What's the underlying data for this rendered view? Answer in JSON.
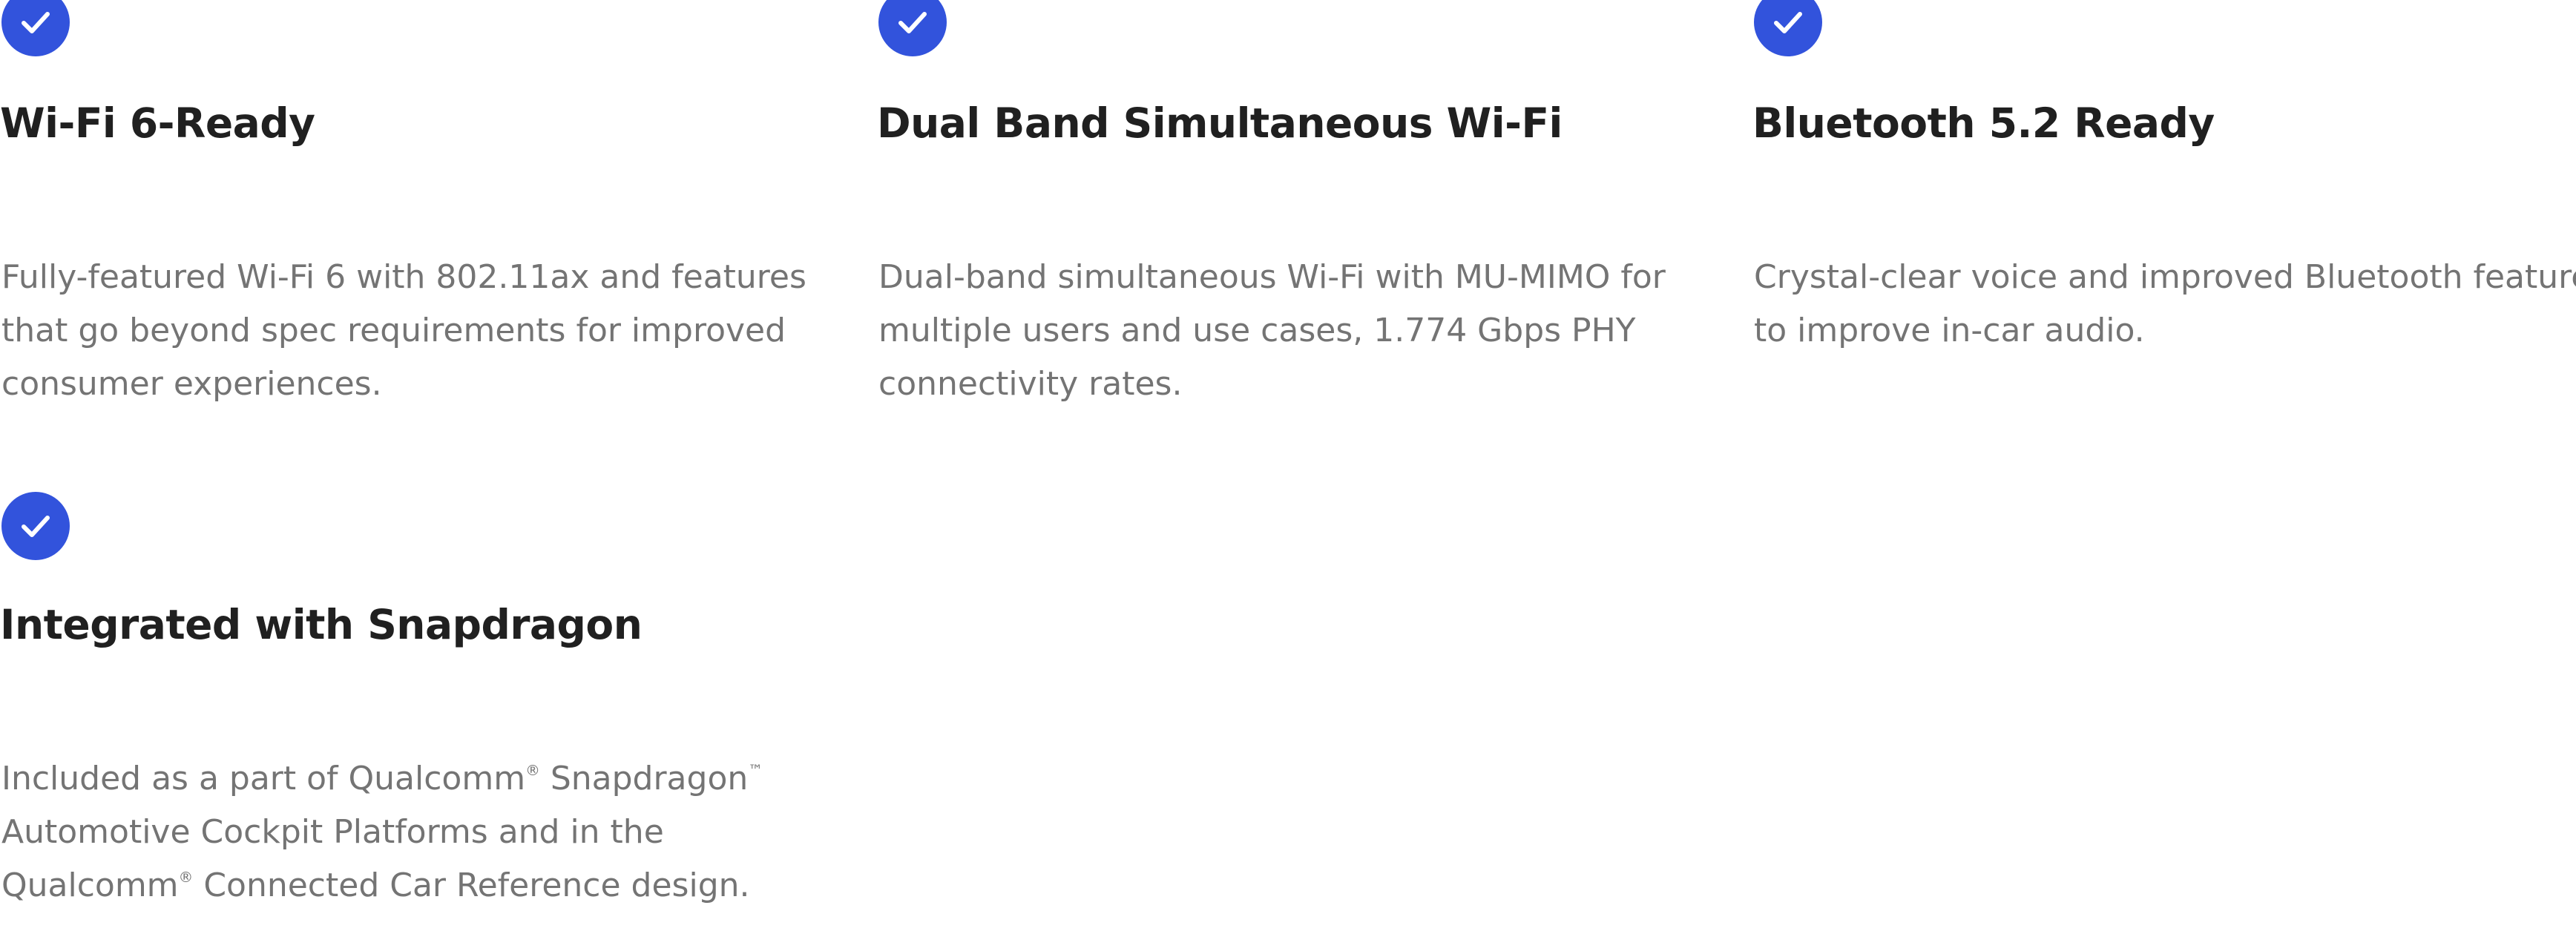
{
  "accent_color": "#3253dc",
  "icon": "check-circle-icon",
  "features": [
    {
      "title": "Wi-Fi 6-Ready",
      "description_lines": [
        "Fully-featured Wi-Fi 6 with 802.11ax and features",
        "that go beyond spec requirements for improved",
        "consumer experiences."
      ]
    },
    {
      "title": "Dual Band Simultaneous Wi-Fi",
      "description_lines": [
        "Dual-band simultaneous Wi-Fi with MU-MIMO for",
        "multiple users and use cases, 1.774 Gbps PHY",
        "connectivity rates."
      ]
    },
    {
      "title": "Bluetooth 5.2 Ready",
      "description_lines": [
        "Crystal-clear voice and improved Bluetooth features",
        "to improve in-car audio."
      ]
    },
    {
      "title": "Integrated with Snapdragon",
      "description_lines": [
        "Included as a part of Qualcomm® Snapdragon™",
        "Automotive Cockpit Platforms and in the",
        "Qualcomm® Connected Car Reference design."
      ]
    }
  ]
}
